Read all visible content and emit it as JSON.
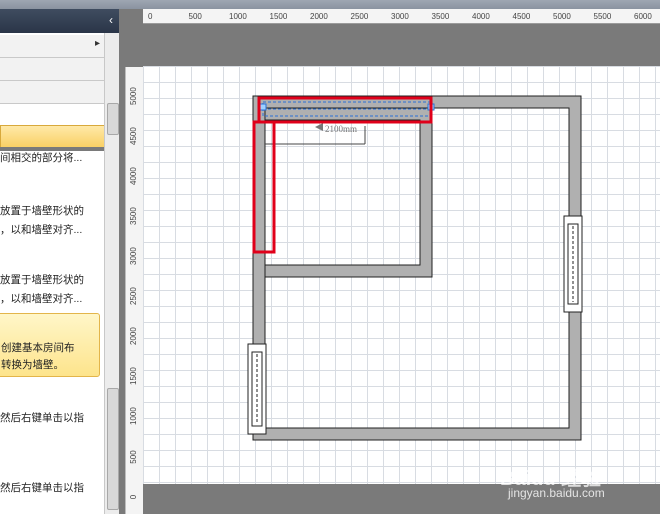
{
  "app": {
    "collapse_icon": "chevron-left-icon"
  },
  "panel": {
    "rows": [
      {
        "label": "",
        "icon": "chevron-right-icon"
      },
      {
        "label": ""
      },
      {
        "label": ""
      },
      {
        "label": "",
        "selected": true
      }
    ],
    "texts": [
      "间相交的部分将...",
      "放置于墙壁形状的",
      "，以和墙壁对齐...",
      "放置于墙壁形状的",
      "，以和墙壁对齐...",
      "然后右键单击以指",
      "然后右键单击以指"
    ],
    "tip": [
      "创建基本房间布",
      "转换为墙壁。"
    ]
  },
  "ruler": {
    "horizontal": [
      "0",
      "500",
      "1000",
      "1500",
      "2000",
      "2500",
      "3000",
      "3500",
      "4000",
      "4500",
      "5000",
      "5500",
      "6000"
    ],
    "vertical": [
      "5000",
      "4500",
      "4000",
      "3500",
      "3000",
      "2500",
      "2000",
      "1500",
      "1000",
      "500",
      "0"
    ]
  },
  "drawing": {
    "dimension_label": "2100mm",
    "colors": {
      "wall": "#b0b0b0",
      "wall_stroke": "#202020",
      "highlight": "#e0001a",
      "selection": "#2a6fd6"
    }
  },
  "watermark": {
    "logo": "Baidu 经验",
    "url": "jingyan.baidu.com"
  }
}
